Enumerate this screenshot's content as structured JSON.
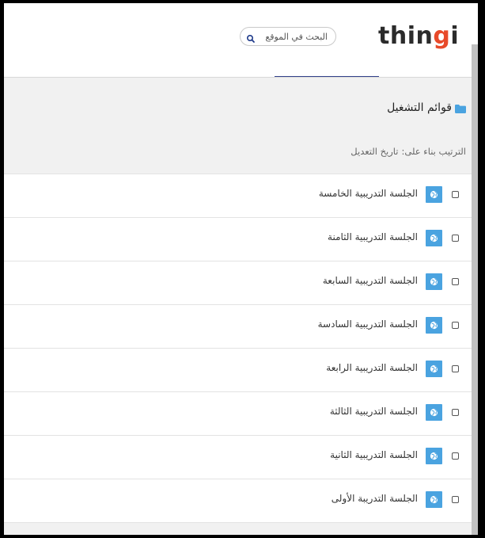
{
  "header": {
    "logo_main": "thin",
    "logo_accent": "g",
    "logo_end": "i",
    "search_placeholder": "البحث في الموقع",
    "search_icon": "magnifier-icon"
  },
  "content": {
    "title": "قوائم التشغيل",
    "folder_icon": "folder-icon",
    "sort_label": "الترتيب بناء على:",
    "sort_value": "تاريخ التعديل",
    "items": [
      {
        "label": "الجلسة التدريبية الخامسة",
        "icon": "globe-icon"
      },
      {
        "label": "الجلسة التدريبية الثامنة",
        "icon": "globe-icon"
      },
      {
        "label": "الجلسة التدريبية السابعة",
        "icon": "globe-icon"
      },
      {
        "label": "الجلسة التدريبية السادسة",
        "icon": "globe-icon"
      },
      {
        "label": "الجلسة التدريبية الرابعة",
        "icon": "globe-icon"
      },
      {
        "label": "الجلسة التدريبية الثالثة",
        "icon": "globe-icon"
      },
      {
        "label": "الجلسة التدريبية الثانية",
        "icon": "globe-icon"
      },
      {
        "label": "الجلسة التدريبة الأولى",
        "icon": "globe-icon"
      }
    ]
  },
  "colors": {
    "accent": "#e84a2a",
    "icon_bg": "#4aa3e0",
    "nav_underline": "#33418a"
  }
}
